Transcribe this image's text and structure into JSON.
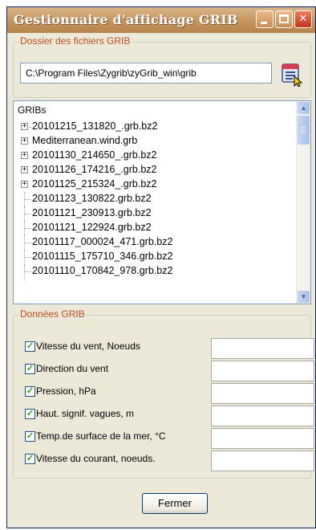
{
  "window": {
    "title": "Gestionnaire d'affichage GRIB",
    "minimize_symbol": "",
    "maximize_symbol": "",
    "close_symbol": "✕"
  },
  "folder_group": {
    "label": "Dossier des fichiers GRIB",
    "path_value": "C:\\Program Files\\Zygrib\\zyGrib_win\\grib",
    "browse_icon": "folder-open-icon"
  },
  "file_tree": {
    "root_label": "GRIBs",
    "items": [
      {
        "label": "20101215_131820_.grb.bz2",
        "expandable": true
      },
      {
        "label": "Mediterranean.wind.grb",
        "expandable": true
      },
      {
        "label": "20101130_214650_.grb.bz2",
        "expandable": true
      },
      {
        "label": "20101126_174216_.grb.bz2",
        "expandable": true
      },
      {
        "label": "20101125_215324_.grb.bz2",
        "expandable": true
      },
      {
        "label": "20101123_130822.grb.bz2",
        "expandable": false
      },
      {
        "label": "20101121_230913.grb.bz2",
        "expandable": false
      },
      {
        "label": "20101121_122924.grb.bz2",
        "expandable": false
      },
      {
        "label": "20101117_000024_471.grb.bz2",
        "expandable": false
      },
      {
        "label": "20101115_175710_346.grb.bz2",
        "expandable": false
      },
      {
        "label": "20101110_170842_978.grb.bz2",
        "expandable": false
      }
    ],
    "expand_symbol": "+",
    "scroll_up_symbol": "▲",
    "scroll_down_symbol": "▼"
  },
  "data_group": {
    "label": "Données GRIB",
    "check_symbol": "✓",
    "rows": [
      {
        "label": "Vitesse du vent, Noeuds",
        "checked": true,
        "value": ""
      },
      {
        "label": "Direction du vent",
        "checked": true,
        "value": ""
      },
      {
        "label": "Pression, hPa",
        "checked": true,
        "value": ""
      },
      {
        "label": "Haut. signif. vagues, m",
        "checked": true,
        "value": ""
      },
      {
        "label": "Temp.de surface de la mer, °C",
        "checked": true,
        "value": ""
      },
      {
        "label": "Vitesse du courant, noeuds.",
        "checked": true,
        "value": ""
      }
    ]
  },
  "footer": {
    "close_label": "Fermer"
  }
}
